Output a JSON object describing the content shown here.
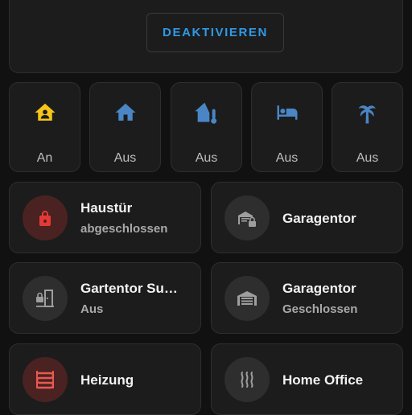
{
  "alarm": {
    "deactivate_label": "DEAKTIVIEREN"
  },
  "modes": [
    {
      "icon": "home-account-icon",
      "state": "An",
      "color": "#f5c518"
    },
    {
      "icon": "home-icon",
      "state": "Aus",
      "color": "#4a86c5"
    },
    {
      "icon": "home-thermometer-icon",
      "state": "Aus",
      "color": "#4a86c5"
    },
    {
      "icon": "bed-icon",
      "state": "Aus",
      "color": "#4a86c5"
    },
    {
      "icon": "palm-tree-icon",
      "state": "Aus",
      "color": "#4a86c5"
    }
  ],
  "tiles": [
    {
      "title": "Haustür",
      "subtitle": "abgeschlossen",
      "icon": "lock-icon",
      "color": "#e53935"
    },
    {
      "title": "Garagentor",
      "subtitle": "",
      "icon": "garage-lock-icon",
      "color": "#9e9e9e"
    },
    {
      "title": "Gartentor Su…",
      "subtitle": "Aus",
      "icon": "door-sliding-lock-icon",
      "color": "#9e9e9e"
    },
    {
      "title": "Garagentor",
      "subtitle": "Geschlossen",
      "icon": "garage-icon",
      "color": "#9e9e9e"
    },
    {
      "title": "Heizung",
      "subtitle": "",
      "icon": "radiator-icon",
      "color": "#e85a4f"
    },
    {
      "title": "Home Office",
      "subtitle": "",
      "icon": "heat-wave-icon",
      "color": "#9e9e9e"
    }
  ]
}
